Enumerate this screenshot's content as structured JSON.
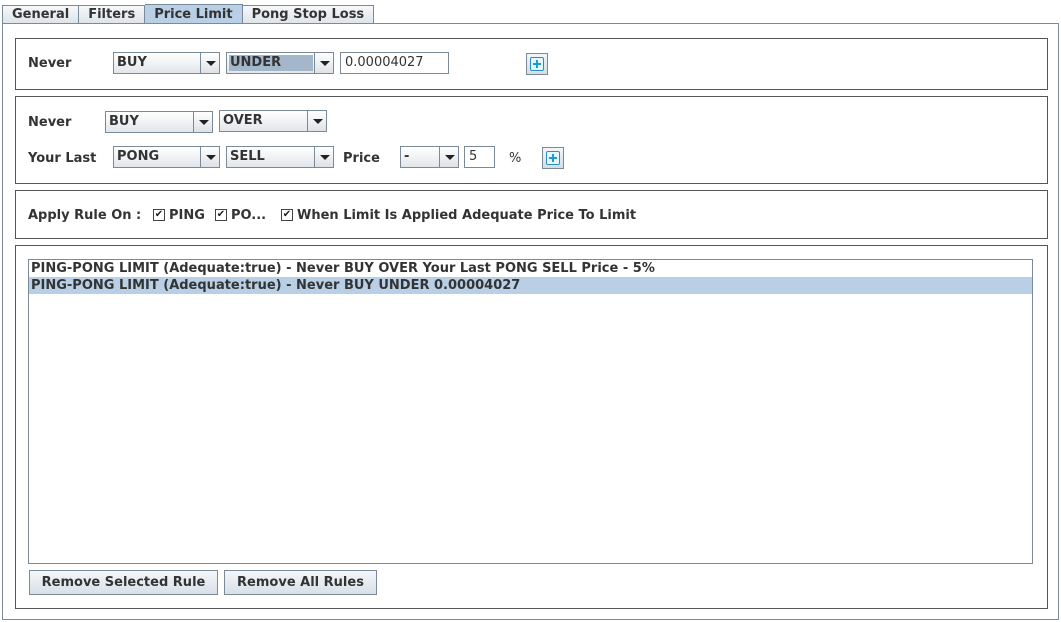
{
  "tabs": [
    {
      "label": "General"
    },
    {
      "label": "Filters"
    },
    {
      "label": "Price Limit"
    },
    {
      "label": "Pong Stop Loss"
    }
  ],
  "selected_tab": "Price Limit",
  "rule1": {
    "never_label": "Never",
    "side_value": "BUY",
    "direction_value": "UNDER",
    "price_value": "0.00004027"
  },
  "rule2": {
    "never_label": "Never",
    "side_value": "BUY",
    "direction_value": "OVER",
    "your_last_label": "Your Last",
    "order_type_value": "PONG",
    "order_side_value": "SELL",
    "price_label": "Price",
    "sign_value": "-",
    "percent_value": "5",
    "percent_symbol": "%"
  },
  "apply": {
    "label": "Apply Rule On :",
    "ping_label": "PING",
    "pong_label": "PO...",
    "adequate_label": "When Limit Is Applied Adequate Price To Limit",
    "ping_checked": true,
    "pong_checked": true,
    "adequate_checked": true
  },
  "rules_list": [
    {
      "text": "PING-PONG LIMIT (Adequate:true) - Never BUY OVER Your Last PONG SELL Price - 5%",
      "selected": false
    },
    {
      "text": "PING-PONG LIMIT (Adequate:true) - Never BUY UNDER 0.00004027",
      "selected": true
    }
  ],
  "buttons": {
    "remove_selected": "Remove Selected Rule",
    "remove_all": "Remove All Rules"
  },
  "colors": {
    "selection": "#b8cfe5",
    "border": "#7a8a99",
    "add_icon": "#1e9bd0"
  }
}
